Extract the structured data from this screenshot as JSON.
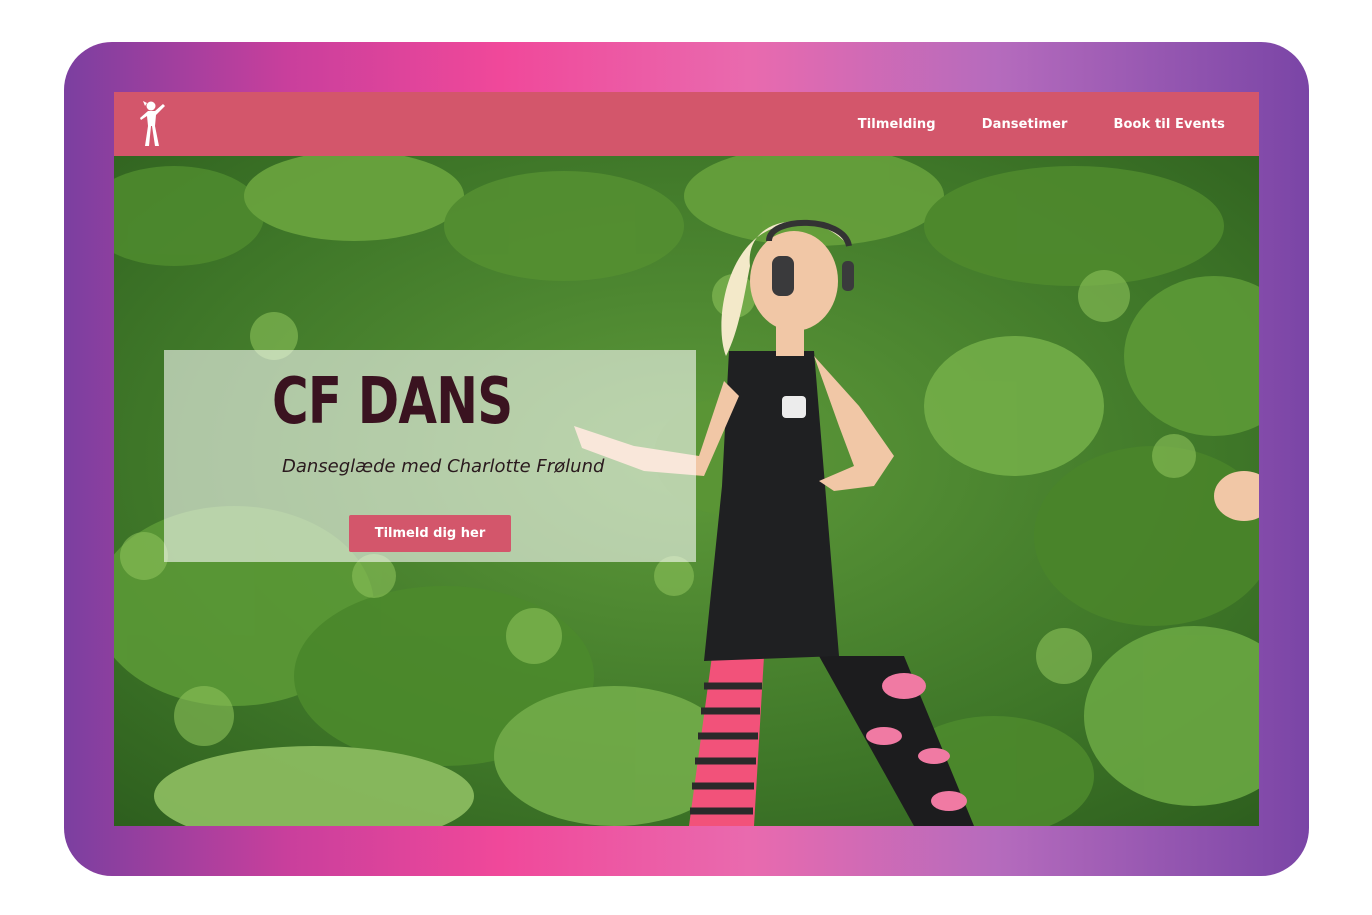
{
  "nav": {
    "logo_icon": "dancer-silhouette-icon",
    "links": [
      "Tilmelding",
      "Dansetimer",
      "Book til Events"
    ]
  },
  "hero": {
    "title": "CF DANS",
    "subtitle": "Danseglæde med Charlotte Frølund",
    "cta_label": "Tilmeld dig her",
    "image_description": "Woman dancing outdoors with headphones in front of green bushes"
  },
  "colors": {
    "frame_gradient": [
      "#7b3fa0",
      "#f0489a",
      "#7a45a6"
    ],
    "navbar": "#d3566b",
    "button": "#d3566b",
    "title_text": "#3a1320"
  }
}
